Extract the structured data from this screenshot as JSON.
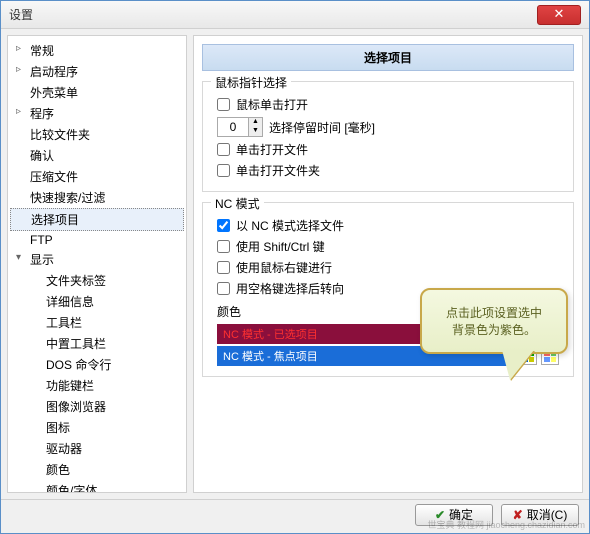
{
  "window": {
    "title": "设置"
  },
  "tree": {
    "items": [
      {
        "label": "常规",
        "arrow": "▹"
      },
      {
        "label": "启动程序",
        "arrow": "▹"
      },
      {
        "label": "外壳菜单"
      },
      {
        "label": "程序",
        "arrow": "▹"
      },
      {
        "label": "比较文件夹"
      },
      {
        "label": "确认"
      },
      {
        "label": "压缩文件"
      },
      {
        "label": "快速搜索/过滤"
      },
      {
        "label": "选择项目",
        "selected": true
      },
      {
        "label": "FTP"
      },
      {
        "label": "显示",
        "arrow": "▾",
        "children": [
          {
            "label": "文件夹标签"
          },
          {
            "label": "详细信息"
          },
          {
            "label": "工具栏"
          },
          {
            "label": "中置工具栏"
          },
          {
            "label": "DOS 命令行"
          },
          {
            "label": "功能键栏"
          },
          {
            "label": "图像浏览器"
          },
          {
            "label": "图标"
          },
          {
            "label": "驱动器"
          },
          {
            "label": "颜色"
          },
          {
            "label": "颜色/字体"
          }
        ]
      }
    ]
  },
  "main": {
    "section_title": "选择项目",
    "group1": {
      "title": "鼠标指针选择",
      "opt1": "鼠标单击打开",
      "dwell_value": "0",
      "dwell_label": "选择停留时间 [毫秒]",
      "opt2": "单击打开文件",
      "opt3": "单击打开文件夹"
    },
    "group2": {
      "title": "NC 模式",
      "opt1": "以 NC 模式选择文件",
      "opt1_checked": true,
      "opt2": "使用 Shift/Ctrl 键",
      "opt3": "使用鼠标右键进行",
      "opt4": "用空格键选择后转向",
      "color_label": "颜色",
      "row1": "NC 模式 - 已选项目",
      "row2": "NC 模式 - 焦点项目"
    }
  },
  "callout": {
    "line1": "点击此项设置选中",
    "line2": "背景色为紫色。"
  },
  "footer": {
    "ok": "确定",
    "cancel": "取消(C)"
  },
  "watermark": "世宝典 教程网  jiaocheng.chazidian.com"
}
